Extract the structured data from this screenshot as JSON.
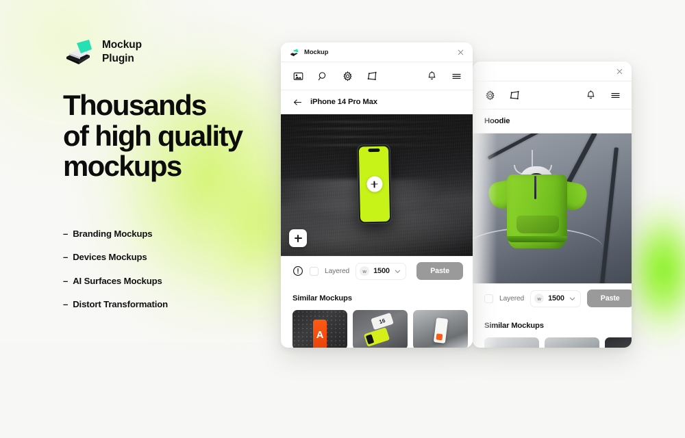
{
  "brand": {
    "name_line1": "Mockup",
    "name_line2": "Plugin",
    "logo_icon": "isometric-layers-logo"
  },
  "headline": {
    "line1": "Thousands",
    "line2": "of high quality",
    "line3": "mockups"
  },
  "features": [
    {
      "dash": "–",
      "label": "Branding Mockups"
    },
    {
      "dash": "–",
      "label": "Devices Mockups"
    },
    {
      "dash": "–",
      "label": "AI Surfaces Mockups"
    },
    {
      "dash": "–",
      "label": "Distort Transformation"
    }
  ],
  "front_window": {
    "titlebar": {
      "title": "Mockup",
      "logo_icon": "mockup-logo-icon",
      "close_icon": "close-icon"
    },
    "toolbar": {
      "icons": [
        {
          "name": "gallery-icon"
        },
        {
          "name": "search-icon"
        },
        {
          "name": "gear-icon"
        },
        {
          "name": "distort-icon"
        },
        {
          "name": "bell-icon"
        },
        {
          "name": "menu-icon"
        }
      ]
    },
    "breadcrumb": {
      "back_icon": "arrow-left-icon",
      "label": "iPhone 14 Pro Max"
    },
    "preview": {
      "screen_color": "#C8F319",
      "background": "dark-sand-texture",
      "center_button_icon": "plus-icon",
      "add_button_icon": "plus-icon"
    },
    "controls": {
      "info_icon": "info-icon",
      "checkbox_checked": false,
      "layered_label": "Layered",
      "width_badge": "w",
      "width_value": "1500",
      "chevron_icon": "chevron-down-icon",
      "paste_label": "Paste"
    },
    "similar": {
      "title": "Similar Mockups",
      "thumbs": [
        {
          "name": "thumb-orange-phone-perforated",
          "letter": "A"
        },
        {
          "name": "thumb-cards-yellow",
          "letter": "16"
        },
        {
          "name": "thumb-white-phone-concrete",
          "letter": ""
        }
      ]
    }
  },
  "back_window": {
    "titlebar": {
      "close_icon": "close-icon"
    },
    "toolbar": {
      "icons": [
        {
          "name": "gear-icon"
        },
        {
          "name": "distort-icon"
        },
        {
          "name": "bell-icon"
        },
        {
          "name": "menu-icon"
        }
      ]
    },
    "breadcrumb": {
      "label": "Hoodie"
    },
    "preview": {
      "background": "grey-studio",
      "subject": "green-hoodie-on-hanger"
    },
    "controls": {
      "checkbox_checked": false,
      "layered_label": "Layered",
      "width_badge": "w",
      "width_value": "1500",
      "chevron_icon": "chevron-down-icon",
      "paste_label": "Paste"
    },
    "similar": {
      "title": "Similar Mockups",
      "thumbs": [
        {
          "name": "thumb-light-grey"
        },
        {
          "name": "thumb-paper-grey"
        },
        {
          "name": "thumb-dark-hangers"
        }
      ]
    }
  },
  "colors": {
    "accent_green": "#C8F319",
    "glow_green": "#8BEF14",
    "paste_grey": "#9A9A9A",
    "page_bg": "#F8F8F6"
  }
}
